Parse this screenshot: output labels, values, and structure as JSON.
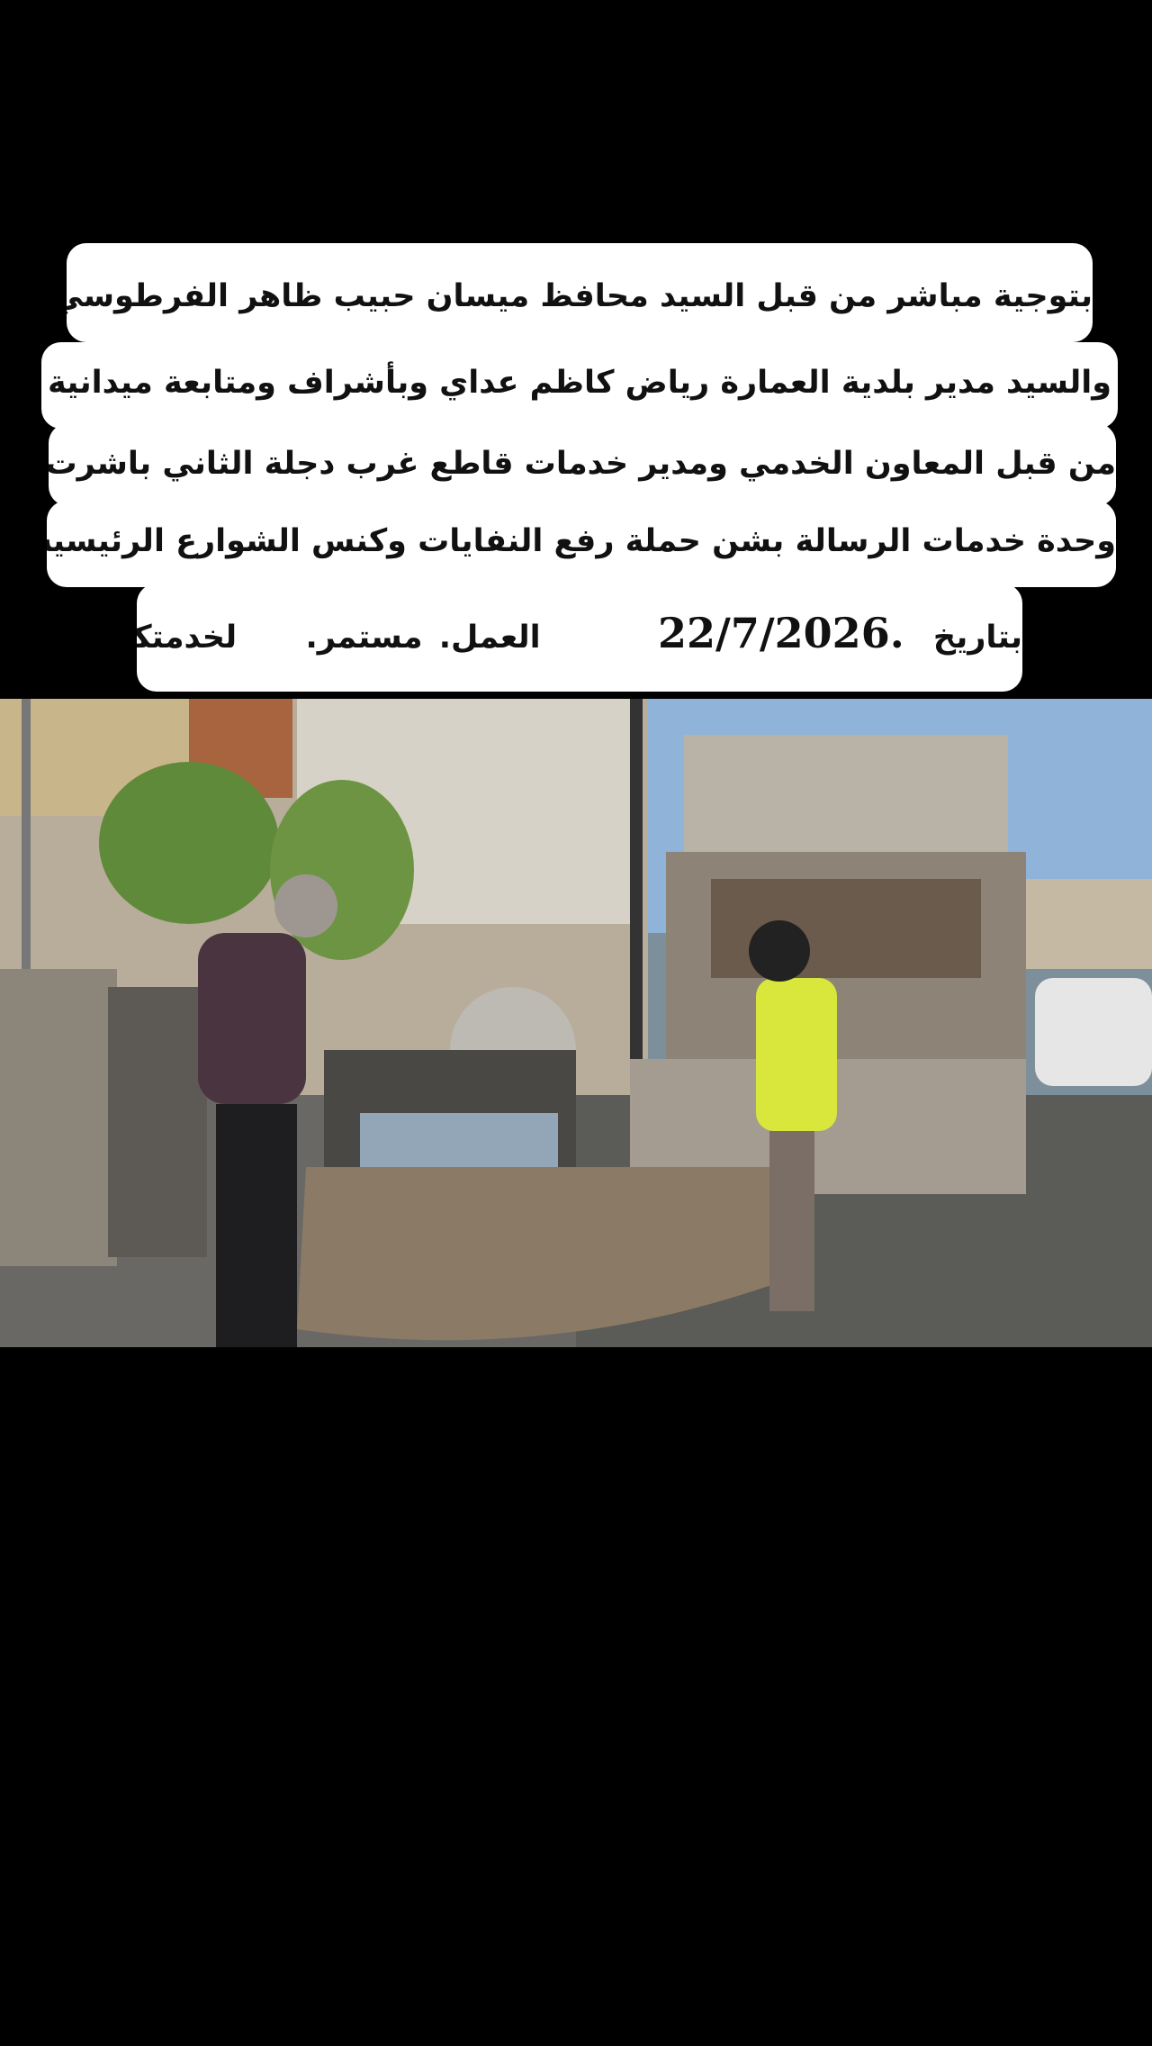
{
  "caption": {
    "line1": "بتوجية مباشر من قبل السيد محافظ ميسان حبيب ظاهر الفرطوسي",
    "line2": "والسيد مدير بلدية العمارة رياض كاظم عداي وبأشراف ومتابعة ميدانية",
    "line3": "من قبل المعاون الخدمي ومدير خدمات قاطع غرب دجلة الثاني باشرت",
    "line4": "وحدة خدمات الرسالة بشن حملة رفع النفايات وكنس الشوارع الرئيسية",
    "line5_prefix": "بتاريخ",
    "line5_date": "22/7/2026.",
    "line5_suffix_1": "العمل.",
    "line5_suffix_2": "مستمر.",
    "line5_suffix_3": "لخدمتكم"
  },
  "photo": {
    "logo_icon": "municipality-emblem-icon",
    "colors": {
      "sky": "#8fb3d9",
      "road": "#5b5b58",
      "truck": "#b9b2a6",
      "vest": "#d9e63c",
      "sack": "#8a7a66"
    }
  }
}
